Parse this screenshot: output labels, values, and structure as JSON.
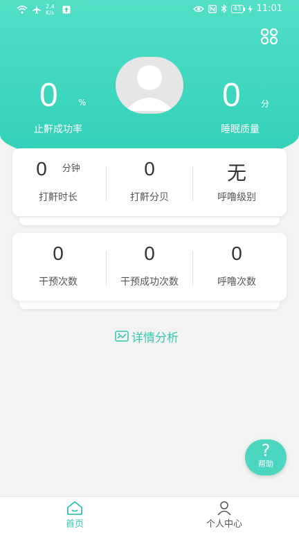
{
  "status_bar": {
    "net_speed_value": "2.4",
    "net_speed_unit": "K/s",
    "battery": "43",
    "time": "11:01"
  },
  "header": {
    "left_stat": {
      "value": "0",
      "unit": "%",
      "label": "止鼾成功率"
    },
    "right_stat": {
      "value": "0",
      "unit": "分",
      "label": "睡眠质量"
    }
  },
  "card1": [
    {
      "value": "0",
      "unit": "分钟",
      "label": "打鼾时长"
    },
    {
      "value": "0",
      "unit": "",
      "label": "打鼾分贝"
    },
    {
      "value": "无",
      "unit": "",
      "label": "呼噜级别"
    }
  ],
  "card2": [
    {
      "value": "0",
      "unit": "",
      "label": "干预次数"
    },
    {
      "value": "0",
      "unit": "",
      "label": "干预成功次数"
    },
    {
      "value": "0",
      "unit": "",
      "label": "呼噜次数"
    }
  ],
  "detail_link": "详情分析",
  "help_button": {
    "symbol": "?",
    "label": "帮助"
  },
  "tabs": [
    {
      "label": "首页",
      "active": true
    },
    {
      "label": "个人中心",
      "active": false
    }
  ],
  "colors": {
    "accent": "#2fd0b6",
    "accent_light": "#52dfc6",
    "tab_active": "#35c9b1",
    "tab_inactive": "#555555"
  }
}
